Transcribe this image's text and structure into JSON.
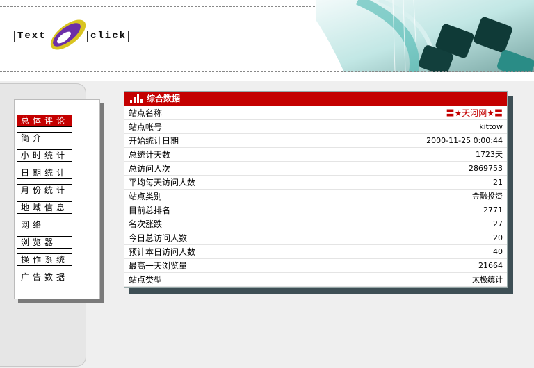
{
  "logo": {
    "left_text": "Text",
    "right_text": "click"
  },
  "nav": {
    "items": [
      {
        "label": "总体评论",
        "active": true
      },
      {
        "label": "简介"
      },
      {
        "label": "小时统计"
      },
      {
        "label": "日期统计"
      },
      {
        "label": "月份统计"
      },
      {
        "label": "地域信息"
      },
      {
        "label": "网络"
      },
      {
        "label": "浏览器"
      },
      {
        "label": "操作系统"
      },
      {
        "label": "广告数据"
      }
    ]
  },
  "panel": {
    "title": "综合数据",
    "rows": [
      {
        "label": "站点名称",
        "value": "〓★天河网★〓"
      },
      {
        "label": "站点帐号",
        "value": "kittow"
      },
      {
        "label": "开始统计日期",
        "value": "2000-11-25 0:00:44"
      },
      {
        "label": "总统计天数",
        "value": "1723天"
      },
      {
        "label": "总访问人次",
        "value": "2869753"
      },
      {
        "label": "平均每天访问人数",
        "value": "21"
      },
      {
        "label": "站点类别",
        "value": "金融投资"
      },
      {
        "label": "目前总排名",
        "value": "2771"
      },
      {
        "label": "名次涨跌",
        "value": "27"
      },
      {
        "label": "今日总访问人数",
        "value": "20"
      },
      {
        "label": "预计本日访问人数",
        "value": "40"
      },
      {
        "label": "最高一天浏览量",
        "value": "21664"
      },
      {
        "label": "站点类型",
        "value": "太极统计"
      }
    ]
  },
  "colors": {
    "accent": "#c40000",
    "panel_shadow": "#3e4f55",
    "header_art": "#1fa6a0"
  }
}
